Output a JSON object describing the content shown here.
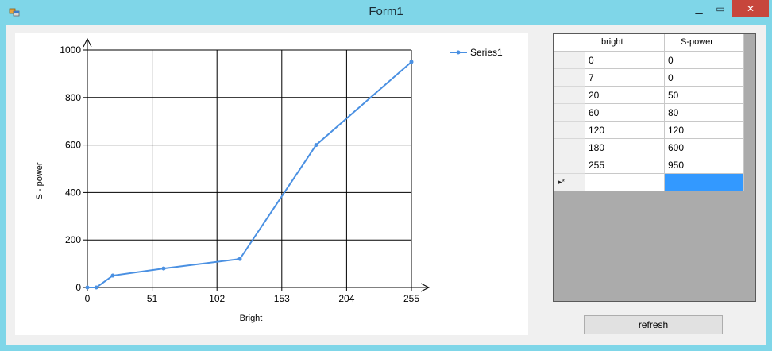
{
  "window": {
    "title": "Form1"
  },
  "controls": {
    "minimize": "▁",
    "maximize": "▭",
    "close": "✕"
  },
  "chart_data": {
    "type": "line",
    "x": [
      0,
      7,
      20,
      60,
      120,
      180,
      255
    ],
    "series": [
      {
        "name": "Series1",
        "values": [
          0,
          0,
          50,
          80,
          120,
          600,
          950
        ]
      }
    ],
    "xlabel": "Bright",
    "ylabel": "S - power",
    "xlim": [
      0,
      255
    ],
    "ylim": [
      0,
      1000
    ],
    "xticks": [
      0,
      51,
      102,
      153,
      204,
      255
    ],
    "yticks": [
      0,
      200,
      400,
      600,
      800,
      1000
    ],
    "grid": true,
    "legend": "top-right",
    "line_color": "#4a90e2"
  },
  "grid": {
    "columns": [
      "bright",
      "S-power"
    ],
    "rows": [
      [
        "0",
        "0"
      ],
      [
        "7",
        "0"
      ],
      [
        "20",
        "50"
      ],
      [
        "60",
        "80"
      ],
      [
        "120",
        "120"
      ],
      [
        "180",
        "600"
      ],
      [
        "255",
        "950"
      ]
    ],
    "new_row_marker": "▸*"
  },
  "buttons": {
    "refresh": "refresh"
  }
}
